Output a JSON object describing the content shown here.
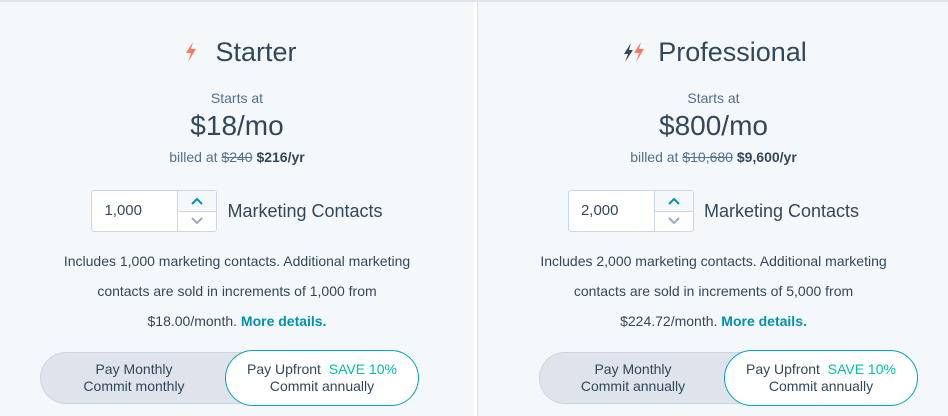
{
  "plans": [
    {
      "name": "Starter",
      "starts_label": "Starts at",
      "price": "$18/mo",
      "billed_prefix": "billed at",
      "billed_old": "$240",
      "billed_new": "$216/yr",
      "contacts_value": "1,000",
      "contacts_label": "Marketing Contacts",
      "desc_line1": "Includes 1,000 marketing contacts. Additional marketing",
      "desc_line2": "contacts are sold in increments of 1,000 from",
      "desc_line3": "$18.00/month.",
      "more_details": "More details.",
      "toggle": {
        "monthly_title": "Pay Monthly",
        "monthly_sub": "Commit monthly",
        "upfront_title": "Pay Upfront",
        "upfront_save": "SAVE 10%",
        "upfront_sub": "Commit annually"
      }
    },
    {
      "name": "Professional",
      "starts_label": "Starts at",
      "price": "$800/mo",
      "billed_prefix": "billed at",
      "billed_old": "$10,680",
      "billed_new": "$9,600/yr",
      "contacts_value": "2,000",
      "contacts_label": "Marketing Contacts",
      "desc_line1": "Includes 2,000 marketing contacts. Additional marketing",
      "desc_line2": "contacts are sold in increments of 5,000 from",
      "desc_line3": "$224.72/month.",
      "more_details": "More details.",
      "toggle": {
        "monthly_title": "Pay Monthly",
        "monthly_sub": "Commit annually",
        "upfront_title": "Pay Upfront",
        "upfront_save": "SAVE 10%",
        "upfront_sub": "Commit annually"
      }
    }
  ],
  "colors": {
    "accent_orange": "#ff7a59",
    "dark_slate": "#33475b",
    "teal_link": "#0091ae",
    "save_green": "#00bda5"
  },
  "icons": {
    "starter": "single-lightning-icon",
    "professional": "double-lightning-icon",
    "up": "chevron-up-icon",
    "down": "chevron-down-icon"
  }
}
